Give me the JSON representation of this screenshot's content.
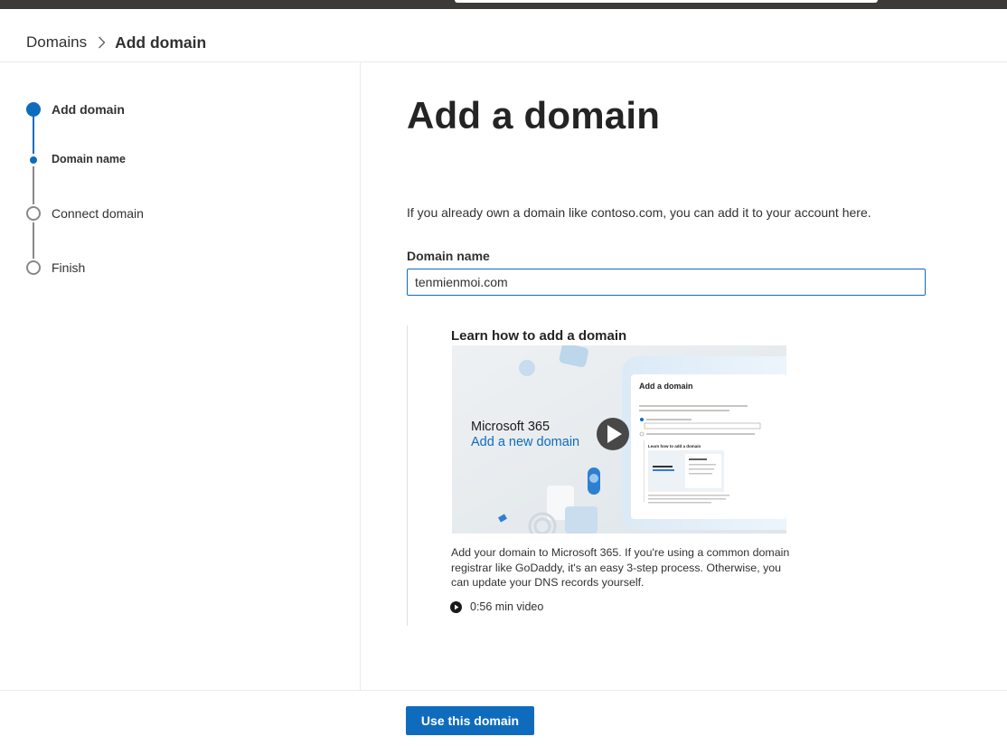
{
  "breadcrumb": {
    "root": "Domains",
    "current": "Add domain"
  },
  "steps": [
    {
      "label": "Add domain",
      "state": "current"
    },
    {
      "label": "Domain name",
      "state": "current-substep"
    },
    {
      "label": "Connect domain",
      "state": "pending"
    },
    {
      "label": "Finish",
      "state": "pending"
    }
  ],
  "main": {
    "title": "Add a domain",
    "description": "If you already own a domain like contoso.com, you can add it to your account here.",
    "domain_label": "Domain name",
    "domain_value": "tenmienmoi.com"
  },
  "video_card": {
    "title": "Learn how to add a domain",
    "thumbnail": {
      "brand": "Microsoft 365",
      "subtitle": "Add a new domain",
      "dialog_title": "Add a domain",
      "dialog_sub_title": "Learn how to add a domain"
    },
    "description": "Add your domain to Microsoft 365. If you're using a common domain registrar like GoDaddy, it's an easy 3-step process. Otherwise, you can update your DNS records yourself.",
    "duration": "0:56 min video"
  },
  "footer": {
    "primary_button": "Use this domain"
  },
  "colors": {
    "accent": "#0f6cbd",
    "top_bar": "#3b3a39",
    "divider": "#edebe9"
  }
}
